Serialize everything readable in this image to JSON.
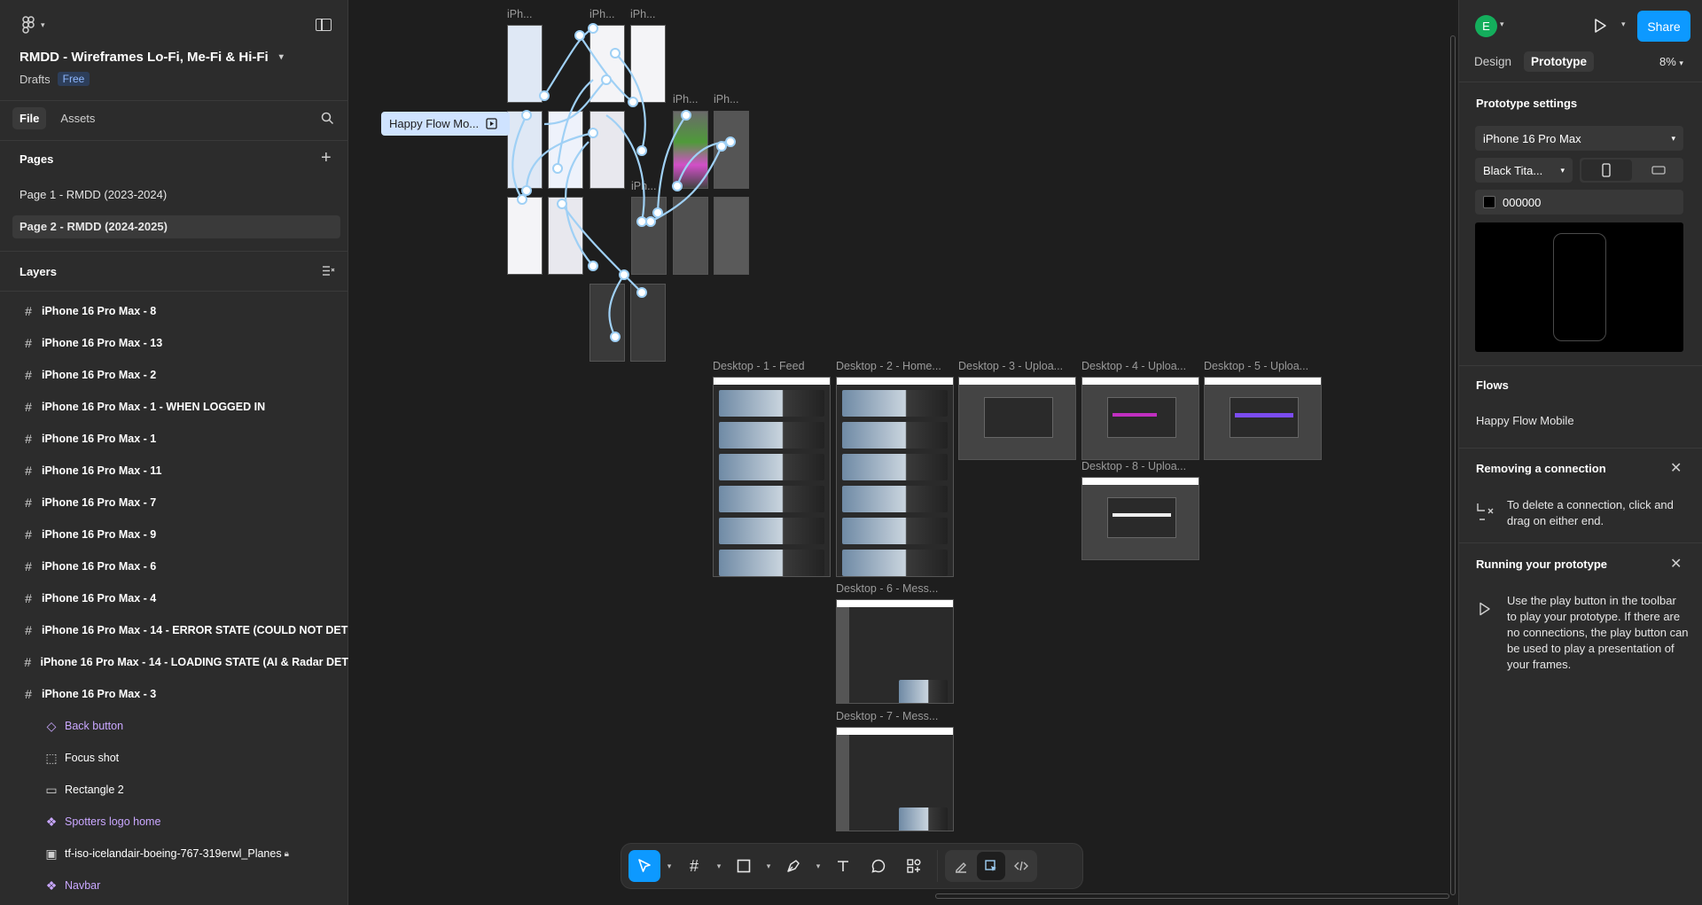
{
  "left_panel": {
    "file_title": "RMDD - Wireframes Lo-Fi, Me-Fi & Hi-Fi",
    "location": "Drafts",
    "plan_badge": "Free",
    "tabs": [
      "File",
      "Assets"
    ],
    "pages_heading": "Pages",
    "pages": [
      "Page 1 - RMDD (2023-2024)",
      "Page 2 - RMDD (2024-2025)"
    ],
    "layers_heading": "Layers",
    "layers": [
      "iPhone 16 Pro Max - 8",
      "iPhone 16 Pro Max - 13",
      "iPhone 16 Pro Max - 2",
      "iPhone 16 Pro Max - 1 - WHEN LOGGED IN",
      "iPhone 16 Pro Max - 1",
      "iPhone 16 Pro Max - 11",
      "iPhone 16 Pro Max - 7",
      "iPhone 16 Pro Max - 9",
      "iPhone 16 Pro Max - 6",
      "iPhone 16 Pro Max - 4",
      "iPhone 16 Pro Max - 14 - ERROR STATE (COULD NOT DET",
      "iPhone 16 Pro Max - 14 - LOADING STATE (AI & Radar DET",
      "iPhone 16 Pro Max - 3"
    ],
    "child_layers": [
      {
        "name": "Back button",
        "icon": "component-instance-icon"
      },
      {
        "name": "Focus shot",
        "icon": "dashed-frame-icon"
      },
      {
        "name": "Rectangle 2",
        "icon": "rectangle-icon"
      },
      {
        "name": "Spotters logo home",
        "icon": "component-instance-icon"
      },
      {
        "name": "tf-iso-icelandair-boeing-767-319erwl_Planes",
        "icon": "image-icon"
      },
      {
        "name": "Navbar",
        "icon": "component-instance-icon"
      }
    ]
  },
  "canvas": {
    "flow_badge": "Happy Flow Mo...",
    "phone_labels": [
      "iPh...",
      "iPh...",
      "iPh...",
      "iPh...",
      "iPh...",
      "iPh..."
    ],
    "desktop_labels": [
      "Desktop - 1 - Feed",
      "Desktop - 2 - Home...",
      "Desktop - 3 - Uploa...",
      "Desktop - 4 - Uploa...",
      "Desktop - 5 - Uploa...",
      "Desktop - 8 - Uploa...",
      "Desktop - 6 - Mess...",
      "Desktop - 7 - Mess..."
    ],
    "help": "?"
  },
  "toolbar": {
    "tools": [
      "move-tool",
      "frame-tool",
      "shape-tool",
      "pen-tool",
      "text-tool",
      "comment-tool",
      "actions-tool",
      "draw-mode",
      "prototype-mode",
      "dev-mode"
    ]
  },
  "right_panel": {
    "avatar_initial": "E",
    "share_label": "Share",
    "tabs": [
      "Design",
      "Prototype"
    ],
    "zoom": "8%",
    "prototype_settings_heading": "Prototype settings",
    "device": "iPhone 16 Pro Max",
    "model_color": "Black Tita...",
    "background_hex": "000000",
    "flows_heading": "Flows",
    "flow_name": "Happy Flow Mobile",
    "removing_heading": "Removing a connection",
    "removing_text": "To delete a connection, click and drag on either end.",
    "running_heading": "Running your prototype",
    "running_text": "Use the play button in the toolbar to play your prototype. If there are no connections, the play button can be used to play a presentation of your frames.",
    "colors": {
      "accent": "#0d99ff",
      "avatar": "#14ae5c",
      "component": "#c9a7ff"
    }
  }
}
